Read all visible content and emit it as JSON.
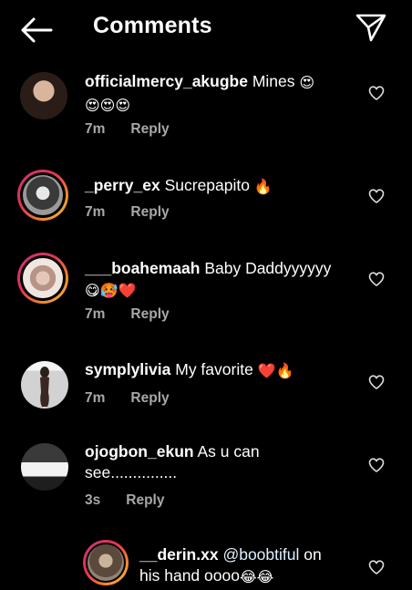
{
  "header": {
    "title": "Comments"
  },
  "comments": [
    {
      "username": "officialmercy_akugbe",
      "text": " Mines",
      "emoji_inline": "😍",
      "emoji_line2": "😍😍😍",
      "time": "7m",
      "reply": "Reply"
    },
    {
      "username": "_perry_ex",
      "text": " Sucrepapito",
      "emoji_inline": "🔥",
      "time": "7m",
      "reply": "Reply"
    },
    {
      "username": "___boahemaah",
      "text": " Baby Daddyyyyyy",
      "emoji_line2": "😋🥵❤️",
      "time": "7m",
      "reply": "Reply"
    },
    {
      "username": "symplylivia",
      "text": " My favorite",
      "emoji_inline": "❤️🔥",
      "time": "7m",
      "reply": "Reply"
    },
    {
      "username": "ojogbon_ekun",
      "text": " As u can",
      "text_line2": "see...............",
      "time": "3s",
      "reply": "Reply"
    },
    {
      "username": "__derin.xx",
      "mention": "@boobtiful",
      "text": " on",
      "text_line2": "his hand oooo",
      "emoji_line2": "😂😂"
    }
  ],
  "colors": {
    "background": "#000000",
    "meta": "#a8a8a8",
    "ring_start": "#c9357b",
    "ring_end": "#f7c14a"
  },
  "icons": [
    "back-arrow-icon",
    "send-paper-plane-icon",
    "heart-outline-icon"
  ]
}
